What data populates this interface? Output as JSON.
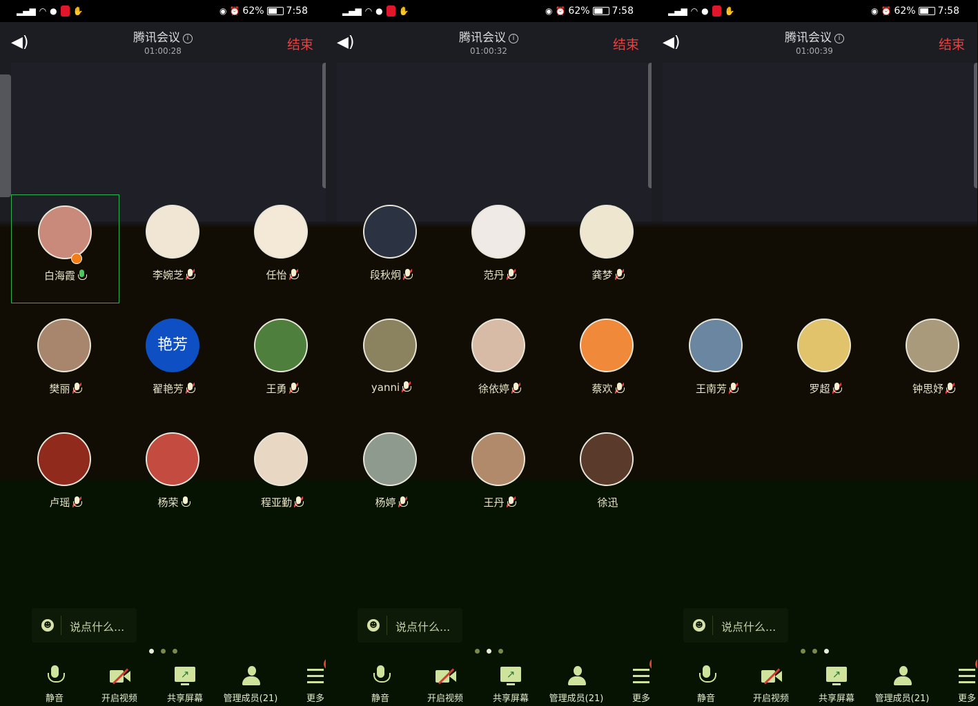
{
  "status_bar": {
    "battery": "62%",
    "time": "7:58"
  },
  "colors": {
    "end": "#e8403e",
    "mic_on": "#49c959",
    "mic_muted": "#e54040",
    "host_badge": "#f57d17",
    "active_border": "#2bb24c"
  },
  "panels": [
    {
      "title": "腾讯会议",
      "timer": "01:00:28",
      "end_label": "结束",
      "active_dot": 0,
      "participants": [
        {
          "name": "白海霞",
          "mic": "on",
          "host": true,
          "active": true,
          "avatar_bg": "#c98a7c"
        },
        {
          "name": "李婉芝",
          "mic": "muted",
          "avatar_bg": "#f0e6d3"
        },
        {
          "name": "任怡",
          "mic": "muted",
          "avatar_bg": "#f4e9d6"
        },
        {
          "name": "樊丽",
          "mic": "muted",
          "avatar_bg": "#a8866d"
        },
        {
          "name": "翟艳芳",
          "mic": "muted",
          "avatar_text": "艳芳",
          "avatar_bg": "#0f4fc4",
          "plain": true
        },
        {
          "name": "王勇",
          "mic": "muted",
          "avatar_bg": "#4f7f3c"
        },
        {
          "name": "卢瑶",
          "mic": "muted",
          "avatar_bg": "#8f2a1d"
        },
        {
          "name": "杨荣",
          "mic": "off",
          "avatar_bg": "#c44b3f"
        },
        {
          "name": "程亚勤",
          "mic": "muted",
          "avatar_bg": "#e8d7c3"
        }
      ]
    },
    {
      "title": "腾讯会议",
      "timer": "01:00:32",
      "end_label": "结束",
      "active_dot": 1,
      "participants": [
        {
          "name": "段秋炯",
          "mic": "muted",
          "avatar_bg": "#2b3242"
        },
        {
          "name": "范丹",
          "mic": "muted",
          "avatar_bg": "#efeae6"
        },
        {
          "name": "龚梦",
          "mic": "muted",
          "avatar_bg": "#efe6cf"
        },
        {
          "name": "yanni",
          "mic": "muted",
          "avatar_bg": "#8b8360"
        },
        {
          "name": "徐依婷",
          "mic": "muted",
          "avatar_bg": "#d8bba6"
        },
        {
          "name": "蔡欢",
          "mic": "muted",
          "avatar_bg": "#f08a3a"
        },
        {
          "name": "杨婷",
          "mic": "muted",
          "avatar_bg": "#8e9a8e"
        },
        {
          "name": "王丹",
          "mic": "muted",
          "avatar_bg": "#b08a6a"
        },
        {
          "name": "徐迅",
          "mic": "none",
          "avatar_bg": "#5a3a2a"
        }
      ]
    },
    {
      "title": "腾讯会议",
      "timer": "01:00:39",
      "end_label": "结束",
      "active_dot": 2,
      "participants": [
        {
          "name": "王南芳",
          "mic": "muted",
          "avatar_bg": "#6a86a0"
        },
        {
          "name": "罗超",
          "mic": "muted",
          "avatar_bg": "#e0c36a"
        },
        {
          "name": "钟思妤",
          "mic": "muted",
          "avatar_bg": "#a89a7a"
        }
      ]
    }
  ],
  "chat_placeholder": "说点什么...",
  "toolbar": [
    {
      "id": "mute",
      "label": "静音",
      "icon": "microphone-icon"
    },
    {
      "id": "video",
      "label": "开启视频",
      "icon": "video-off-icon"
    },
    {
      "id": "share",
      "label": "共享屏幕",
      "icon": "share-screen-icon"
    },
    {
      "id": "members",
      "label": "管理成员(21)",
      "icon": "members-icon"
    },
    {
      "id": "more",
      "label": "更多",
      "icon": "menu-icon",
      "badge": "1"
    }
  ]
}
